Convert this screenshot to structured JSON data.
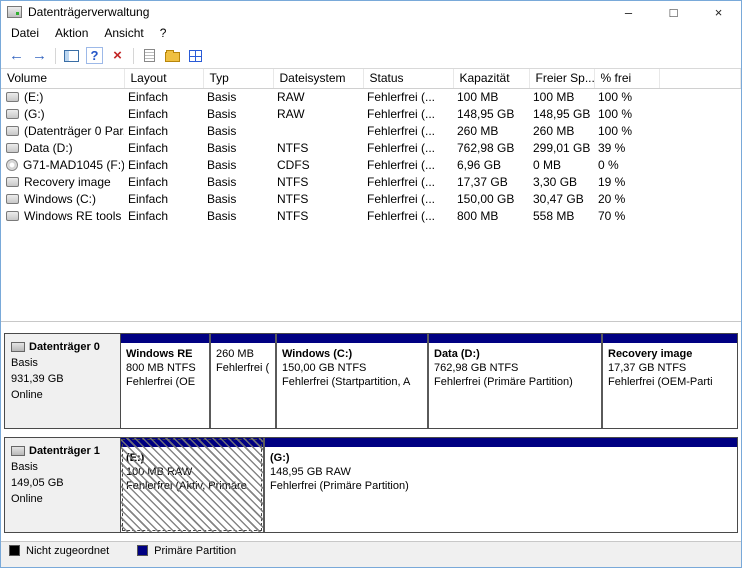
{
  "window": {
    "title": "Datenträgerverwaltung",
    "controls": {
      "minimize": "–",
      "maximize": "□",
      "close": "×"
    }
  },
  "menu": {
    "items": [
      "Datei",
      "Aktion",
      "Ansicht",
      "?"
    ]
  },
  "toolbar": {
    "back_glyph": "←",
    "forward_glyph": "→",
    "help_glyph": "?",
    "delete_glyph": "×"
  },
  "volume_list": {
    "columns": [
      "Volume",
      "Layout",
      "Typ",
      "Dateisystem",
      "Status",
      "Kapazität",
      "Freier Sp...",
      "% frei"
    ],
    "rows": [
      {
        "volume": "(E:)",
        "layout": "Einfach",
        "typ": "Basis",
        "dateisystem": "RAW",
        "status": "Fehlerfrei (...",
        "kapazitaet": "100 MB",
        "freier_sp": "100 MB",
        "prozent_frei": "100 %"
      },
      {
        "volume": "(G:)",
        "layout": "Einfach",
        "typ": "Basis",
        "dateisystem": "RAW",
        "status": "Fehlerfrei (...",
        "kapazitaet": "148,95 GB",
        "freier_sp": "148,95 GB",
        "prozent_frei": "100 %"
      },
      {
        "volume": "(Datenträger 0 Par...",
        "layout": "Einfach",
        "typ": "Basis",
        "dateisystem": "",
        "status": "Fehlerfrei (...",
        "kapazitaet": "260 MB",
        "freier_sp": "260 MB",
        "prozent_frei": "100 %"
      },
      {
        "volume": "Data (D:)",
        "layout": "Einfach",
        "typ": "Basis",
        "dateisystem": "NTFS",
        "status": "Fehlerfrei (...",
        "kapazitaet": "762,98 GB",
        "freier_sp": "299,01 GB",
        "prozent_frei": "39 %"
      },
      {
        "volume": "G71-MAD1045 (F:)",
        "layout": "Einfach",
        "typ": "Basis",
        "dateisystem": "CDFS",
        "status": "Fehlerfrei (...",
        "kapazitaet": "6,96 GB",
        "freier_sp": "0 MB",
        "prozent_frei": "0 %"
      },
      {
        "volume": "Recovery image",
        "layout": "Einfach",
        "typ": "Basis",
        "dateisystem": "NTFS",
        "status": "Fehlerfrei (...",
        "kapazitaet": "17,37 GB",
        "freier_sp": "3,30 GB",
        "prozent_frei": "19 %"
      },
      {
        "volume": "Windows (C:)",
        "layout": "Einfach",
        "typ": "Basis",
        "dateisystem": "NTFS",
        "status": "Fehlerfrei (...",
        "kapazitaet": "150,00 GB",
        "freier_sp": "30,47 GB",
        "prozent_frei": "20 %"
      },
      {
        "volume": "Windows RE tools",
        "layout": "Einfach",
        "typ": "Basis",
        "dateisystem": "NTFS",
        "status": "Fehlerfrei (...",
        "kapazitaet": "800 MB",
        "freier_sp": "558 MB",
        "prozent_frei": "70 %"
      }
    ]
  },
  "disks": [
    {
      "name": "Datenträger 0",
      "type": "Basis",
      "size": "931,39 GB",
      "status": "Online",
      "partitions": [
        {
          "name": "Windows RE",
          "info": "800 MB NTFS",
          "status": "Fehlerfrei (OE"
        },
        {
          "name": "",
          "info": "260 MB",
          "status": "Fehlerfrei ("
        },
        {
          "name": "Windows  (C:)",
          "info": "150,00 GB NTFS",
          "status": "Fehlerfrei (Startpartition, A"
        },
        {
          "name": "Data  (D:)",
          "info": "762,98 GB NTFS",
          "status": "Fehlerfrei (Primäre Partition)"
        },
        {
          "name": "Recovery image",
          "info": "17,37 GB NTFS",
          "status": "Fehlerfrei (OEM-Parti"
        }
      ]
    },
    {
      "name": "Datenträger 1",
      "type": "Basis",
      "size": "149,05 GB",
      "status": "Online",
      "partitions": [
        {
          "name": "(E:)",
          "info": "100 MB RAW",
          "status": "Fehlerfrei (Aktiv, Primäre"
        },
        {
          "name": "(G:)",
          "info": "148,95 GB RAW",
          "status": "Fehlerfrei (Primäre Partition)"
        }
      ]
    }
  ],
  "legend": {
    "items": [
      {
        "label": "Nicht zugeordnet",
        "color": "#000000"
      },
      {
        "label": "Primäre Partition",
        "color": "#000082"
      }
    ]
  },
  "colors": {
    "primary_partition": "#000082",
    "unallocated": "#000000"
  }
}
